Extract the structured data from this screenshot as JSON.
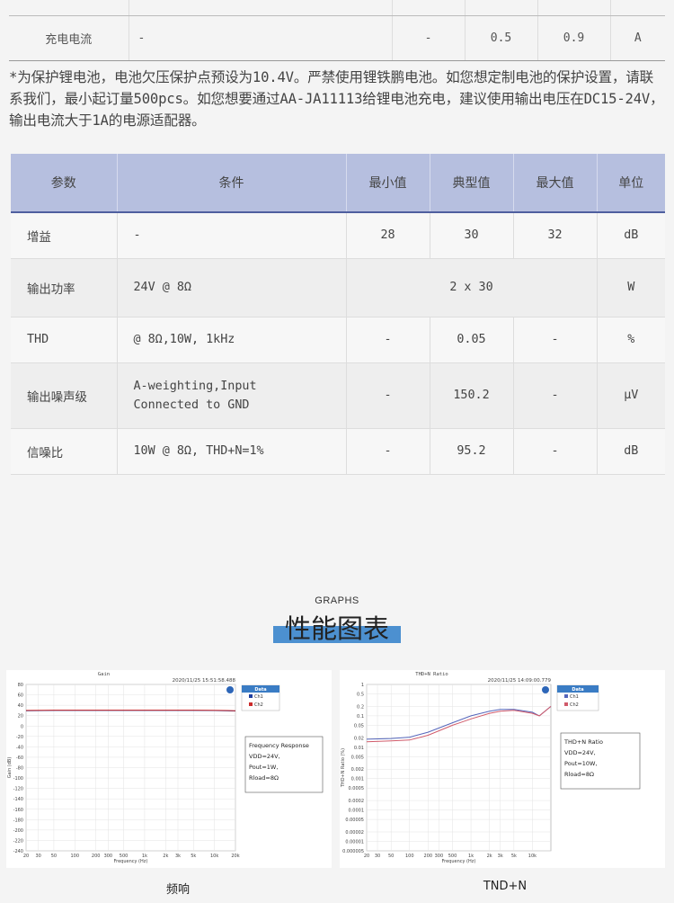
{
  "top_table": {
    "row": {
      "param": "充电电流",
      "cond": "-",
      "min": "-",
      "typ": "0.5",
      "max": "0.9",
      "unit": "A"
    }
  },
  "note": "*为保护锂电池，电池欠压保护点预设为10.4V。严禁使用锂铁鹏电池。如您想定制电池的保护设置，请联系我们，最小起订量500pcs。如您想要通过AA-JA11113给锂电池充电，建议使用输出电压在DC15-24V，输出电流大于1A的电源适配器。",
  "spec_table": {
    "headers": [
      "参数",
      "条件",
      "最小值",
      "典型值",
      "最大值",
      "单位"
    ],
    "rows": [
      {
        "param": "增益",
        "cond": "-",
        "cond2": "",
        "min": "28",
        "typ": "30",
        "max": "32",
        "unit": "dB"
      },
      {
        "param": "输出功率",
        "cond": "24V @ 8Ω",
        "cond2": "",
        "min": "",
        "typ": "2 x 30",
        "max": "",
        "unit": "W"
      },
      {
        "param": "THD",
        "cond": "@ 8Ω,10W, 1kHz",
        "cond2": "",
        "min": "-",
        "typ": "0.05",
        "max": "-",
        "unit": "%"
      },
      {
        "param": "输出噪声级",
        "cond": "A-weighting,Input",
        "cond2": "Connected to GND",
        "min": "-",
        "typ": "150.2",
        "max": "-",
        "unit": "μV"
      },
      {
        "param": "信噪比",
        "cond": "10W @ 8Ω, THD+N=1%",
        "cond2": "",
        "min": "-",
        "typ": "95.2",
        "max": "-",
        "unit": "dB"
      }
    ]
  },
  "graphs": {
    "label": "GRAPHS",
    "title": "性能图表"
  },
  "chart_data": [
    {
      "type": "line",
      "title": "Gain",
      "timestamp": "2020/11/25 15:51:58.488",
      "xlabel": "Frequency (Hz)",
      "ylabel": "Gain (dB)",
      "xscale": "log",
      "xlim": [
        20,
        20000
      ],
      "ylim": [
        -240,
        80
      ],
      "x_ticks": [
        "20",
        "30",
        "50",
        "100",
        "200",
        "300",
        "500",
        "1k",
        "2k",
        "3k",
        "5k",
        "10k",
        "20k"
      ],
      "y_ticks": [
        "80",
        "60",
        "40",
        "20",
        "0",
        "-20",
        "-40",
        "-60",
        "-80",
        "-100",
        "-120",
        "-140",
        "-160",
        "-180",
        "-200",
        "-220",
        "-240"
      ],
      "legend_title": "Data",
      "legend_position": "top-right",
      "annotation": [
        "Frequency Response",
        "VDD=24V,",
        "Pout=1W,",
        "Rload=8Ω"
      ],
      "series": [
        {
          "name": "Ch1",
          "color": "#1f3f9f",
          "x": [
            20,
            50,
            100,
            200,
            500,
            1000,
            2000,
            5000,
            10000,
            20000
          ],
          "y": [
            29.5,
            30,
            30,
            30,
            30,
            30,
            30,
            30,
            29.8,
            29
          ]
        },
        {
          "name": "Ch2",
          "color": "#cc2a2a",
          "x": [
            20,
            50,
            100,
            200,
            500,
            1000,
            2000,
            5000,
            10000,
            20000
          ],
          "y": [
            30,
            30.5,
            30.5,
            30.5,
            30.5,
            30.5,
            30.5,
            30.5,
            30.3,
            29.5
          ]
        }
      ]
    },
    {
      "type": "line",
      "title": "THD+N Ratio",
      "timestamp": "2020/11/25 14:09:00.779",
      "xlabel": "Frequency (Hz)",
      "ylabel": "THD+N Ratio (%)",
      "xscale": "log",
      "yscale": "log",
      "xlim": [
        20,
        20000
      ],
      "ylim": [
        5e-06,
        1
      ],
      "x_ticks": [
        "20",
        "30",
        "50",
        "100",
        "200",
        "300",
        "500",
        "1k",
        "2k",
        "3k",
        "5k",
        "10k"
      ],
      "y_ticks": [
        "1",
        "0.5",
        "0.2",
        "0.1",
        "0.05",
        "0.02",
        "0.01",
        "0.005",
        "0.002",
        "0.001",
        "0.0005",
        "0.0002",
        "0.0001",
        "0.00005",
        "0.00002",
        "0.00001",
        "0.000005"
      ],
      "legend_title": "Data",
      "legend_position": "top-right",
      "annotation": [
        "THD+N Ratio",
        "VDD=24V,",
        "Pout=10W,",
        "Rload=8Ω"
      ],
      "series": [
        {
          "name": "Ch1",
          "color": "#5566bb",
          "x": [
            20,
            50,
            100,
            200,
            500,
            1000,
            2000,
            3000,
            5000,
            10000,
            13000,
            20000
          ],
          "y": [
            0.018,
            0.019,
            0.021,
            0.03,
            0.06,
            0.1,
            0.14,
            0.16,
            0.16,
            0.13,
            0.1,
            0.2
          ]
        },
        {
          "name": "Ch2",
          "color": "#d05a6a",
          "x": [
            20,
            50,
            100,
            200,
            500,
            1000,
            2000,
            3000,
            5000,
            10000,
            13000,
            20000
          ],
          "y": [
            0.015,
            0.016,
            0.017,
            0.024,
            0.05,
            0.08,
            0.12,
            0.14,
            0.15,
            0.12,
            0.1,
            0.2
          ]
        }
      ]
    }
  ],
  "captions": [
    "频响",
    "TND+N"
  ]
}
